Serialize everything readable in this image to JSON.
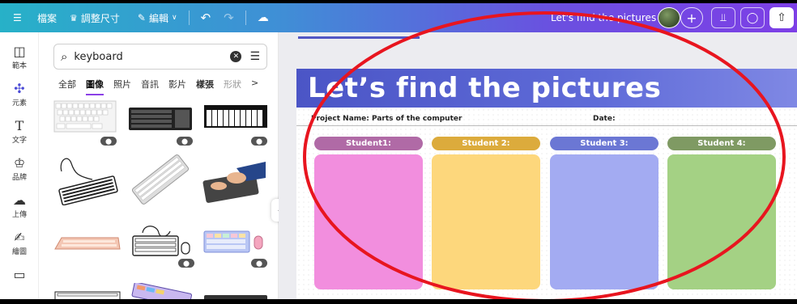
{
  "topbar": {
    "menu_icon": "hamburger-icon",
    "file_label": "檔案",
    "resize_label": "調整尺寸",
    "edit_label": "編輯",
    "title": "Let's find the pictures",
    "plus_label": "+"
  },
  "rail": {
    "items": [
      {
        "label": "範本",
        "icon": "template-icon"
      },
      {
        "label": "元素",
        "icon": "elements-icon"
      },
      {
        "label": "文字",
        "icon": "text-icon"
      },
      {
        "label": "品牌",
        "icon": "brand-icon"
      },
      {
        "label": "上傳",
        "icon": "upload-icon"
      },
      {
        "label": "繪圖",
        "icon": "draw-icon"
      },
      {
        "label": "",
        "icon": "folder-icon"
      }
    ]
  },
  "panel": {
    "search_value": "keyboard",
    "tabs": [
      "全部",
      "圖像",
      "照片",
      "音訊",
      "影片",
      "樣張",
      "形狀"
    ],
    "active_tab": "圖像",
    "tabs_more": ">"
  },
  "slide": {
    "title": "Let’s find the pictures",
    "project_label": "Project Name:  Parts of the computer",
    "date_label": "Date:",
    "columns": [
      {
        "label": "Student1:",
        "head_color": "#b06aa6",
        "box_color": "#f28ede"
      },
      {
        "label": "Student 2:",
        "head_color": "#dcab3c",
        "box_color": "#fdd77c"
      },
      {
        "label": "Student 3:",
        "head_color": "#6b77d4",
        "box_color": "#a3abf2"
      },
      {
        "label": "Student 4:",
        "head_color": "#7f9a63",
        "box_color": "#a4d184"
      }
    ]
  },
  "colors": {
    "accent": "#8b3fe6",
    "annotation": "#e8151f"
  }
}
